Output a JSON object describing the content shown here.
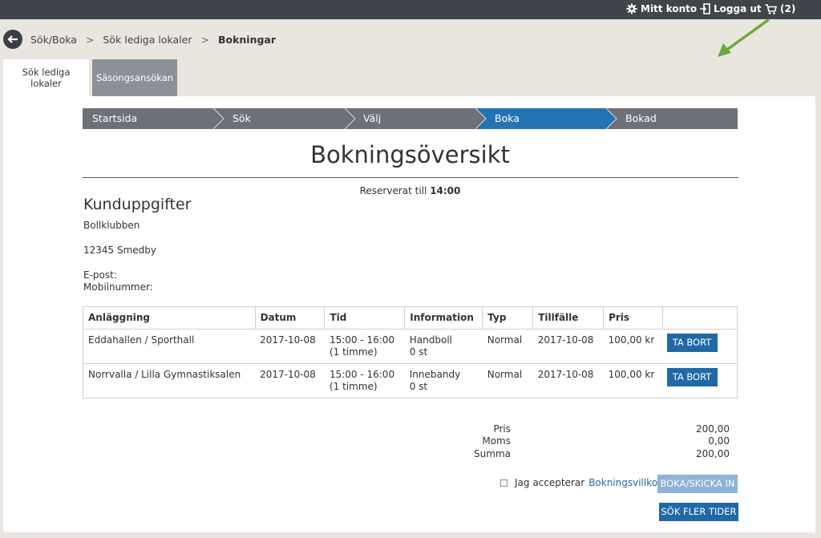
{
  "topbar": {
    "account_label": "Mitt konto",
    "logout_label": "Logga ut",
    "cart_label": "(2)"
  },
  "breadcrumb": {
    "items": [
      "Sök/Boka",
      "Sök lediga lokaler"
    ],
    "separator": ">",
    "current": "Bokningar"
  },
  "tabs": [
    {
      "label": "Sök lediga lokaler",
      "active": true
    },
    {
      "label": "Säsongsansökan",
      "active": false
    }
  ],
  "steps": [
    {
      "label": "Startsida",
      "active": false
    },
    {
      "label": "Sök",
      "active": false
    },
    {
      "label": "Välj",
      "active": false
    },
    {
      "label": "Boka",
      "active": true
    },
    {
      "label": "Bokad",
      "active": false
    }
  ],
  "page_title": "Bokningsöversikt",
  "reserved": {
    "label": "Reserverat till",
    "time": "14:00"
  },
  "customer": {
    "heading": "Kunduppgifter",
    "name": "Bollklubben",
    "address": "12345 Smedby",
    "email_label": "E-post:",
    "mobile_label": "Mobilnummer:"
  },
  "bookings": {
    "headers": [
      "Anläggning",
      "Datum",
      "Tid",
      "Information",
      "Typ",
      "Tillfälle",
      "Pris",
      ""
    ],
    "rows": [
      {
        "facility": "Eddahallen / Sporthall",
        "date": "2017-10-08",
        "time": "15:00 - 16:00",
        "duration": "(1 timme)",
        "info": "Handboll",
        "count": "0 st",
        "type": "Normal",
        "occasion": "2017-10-08",
        "price": "100,00 kr",
        "action": "TA BORT"
      },
      {
        "facility": "Norrvalla / Lilla Gymnastiksalen",
        "date": "2017-10-08",
        "time": "15:00 - 16:00",
        "duration": "(1 timme)",
        "info": "Innebandy",
        "count": "0 st",
        "type": "Normal",
        "occasion": "2017-10-08",
        "price": "100,00 kr",
        "action": "TA BORT"
      }
    ]
  },
  "summary": {
    "price_label": "Pris",
    "price": "200,00",
    "vat_label": "Moms",
    "vat": "0,00",
    "total_label": "Summa",
    "total": "200,00"
  },
  "terms": {
    "accept_label": "Jag accepterar",
    "link_label": "Bokningsvillkor",
    "checked": false
  },
  "buttons": {
    "submit": "BOKA/SKICKA IN",
    "search_more": "SÖK FLER TIDER"
  },
  "colors": {
    "topbar": "#40444b",
    "step_inactive": "#6d7078",
    "step_active": "#2373b5",
    "primary_button": "#2069a6",
    "disabled_button": "#8db3d6",
    "annotation_arrow": "#6aab3a"
  }
}
